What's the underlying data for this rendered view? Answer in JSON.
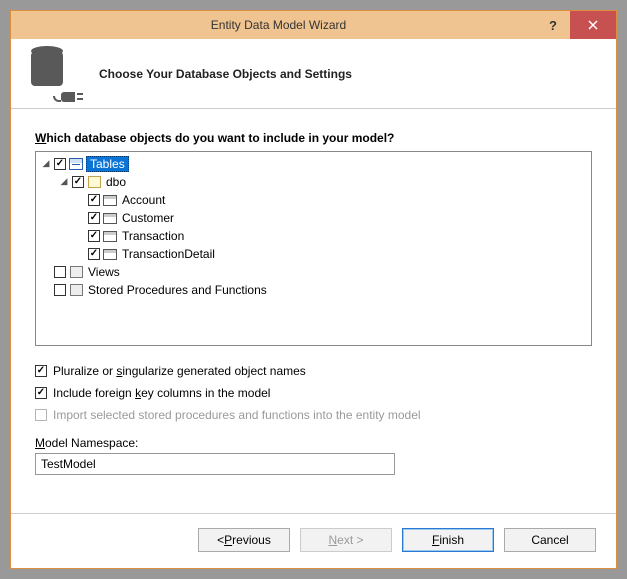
{
  "window": {
    "title": "Entity Data Model Wizard"
  },
  "header": {
    "subtitle": "Choose Your Database Objects and Settings"
  },
  "prompt": {
    "pre": "W",
    "rest": "hich database objects do you want to include in your model?"
  },
  "tree": {
    "tables_label": "Tables",
    "schema_label": "dbo",
    "items": [
      {
        "label": "Account"
      },
      {
        "label": "Customer"
      },
      {
        "label": "Transaction"
      },
      {
        "label": "TransactionDetail"
      }
    ],
    "views_label": "Views",
    "sp_label": "Stored Procedures and Functions"
  },
  "options": {
    "pluralize_pre": "Pluralize or ",
    "pluralize_ul": "s",
    "pluralize_post": "ingularize generated object names",
    "fk_pre": "Include foreign ",
    "fk_ul": "k",
    "fk_post": "ey columns in the model",
    "import_sp": "Import selected stored procedures and functions into the entity model"
  },
  "ns": {
    "label_pre": "",
    "label_ul": "M",
    "label_post": "odel Namespace:",
    "value": "TestModel"
  },
  "buttons": {
    "prev_pre": "< ",
    "prev_ul": "P",
    "prev_post": "revious",
    "next_pre": "",
    "next_ul": "N",
    "next_post": "ext >",
    "finish_pre": "",
    "finish_ul": "F",
    "finish_post": "inish",
    "cancel": "Cancel"
  }
}
